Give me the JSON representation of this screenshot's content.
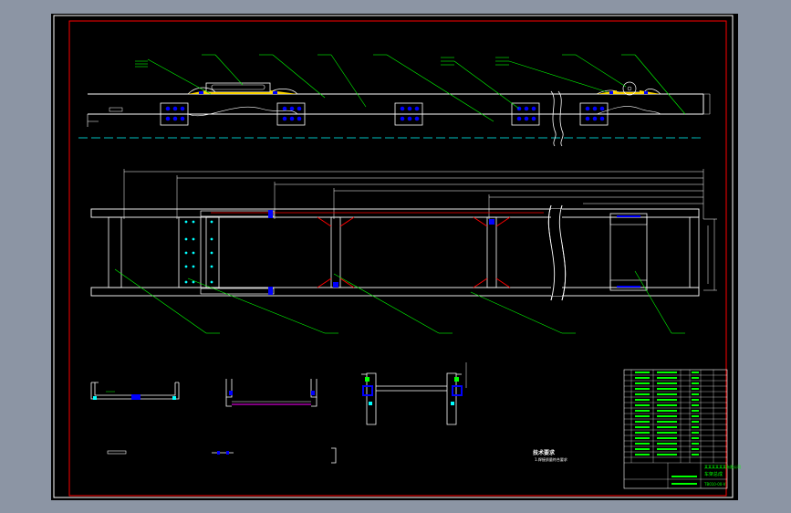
{
  "drawing": {
    "tech_requirements_title": "技术要求",
    "tech_requirements_line1": "1.焊接质量符合要求",
    "title_block": {
      "company": "某某某某某某有限公司",
      "drawing_name": "车架总成",
      "drawing_number": "TB010-00-V"
    }
  },
  "colors": {
    "background": "#000000",
    "frame": "#ff0000",
    "part_outline": "#ffffff",
    "leader": "#00ff00",
    "centerline": "#00ffff",
    "bolt_block": "#0000ff",
    "weld": "#ffd700",
    "crossmember_section": "#ff00ff"
  }
}
